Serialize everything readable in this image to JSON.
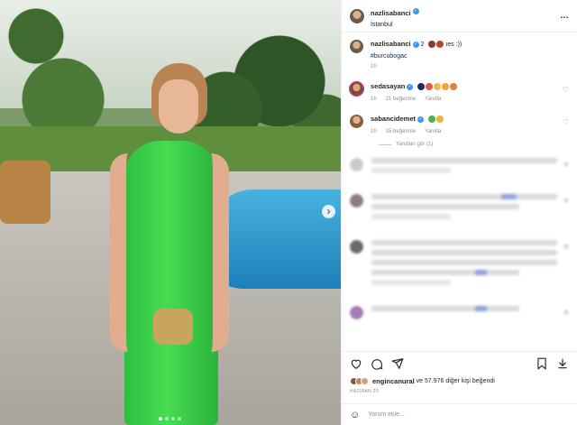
{
  "post": {
    "author": "nazlisabanci",
    "location": "İstanbul",
    "more_label": "…"
  },
  "caption": {
    "username": "nazlisabanci",
    "text_prefix": "2",
    "text_suffix": "ıes :))",
    "hashtag": "#burcubogac",
    "time": "1h"
  },
  "comments": [
    {
      "username": "sedasayan",
      "time": "1h",
      "likes": "21 beğenme",
      "reply_label": "Yanıtla",
      "emoji_colors": [
        "#1d2a5b",
        "#e05a4b",
        "#f2b84b",
        "#f1a33b",
        "#e97a4a"
      ]
    },
    {
      "username": "sabancidemet",
      "time": "1h",
      "likes": "15 beğenme",
      "reply_label": "Yanıtla",
      "emoji_colors": [
        "#4bb04f",
        "#f1b13b"
      ]
    }
  ],
  "view_replies": "Yanıtları gör (1)",
  "actions": {
    "likes_user": "engincanural",
    "likes_text": "ve 57.976 diğer kişi beğendi",
    "date": "HAZİRAN 20"
  },
  "comment_input": {
    "placeholder": "Yorum ekle..."
  },
  "colors": {
    "verified": "#3897f0",
    "hashtag": "#00376b",
    "dress": "#39cc45"
  }
}
